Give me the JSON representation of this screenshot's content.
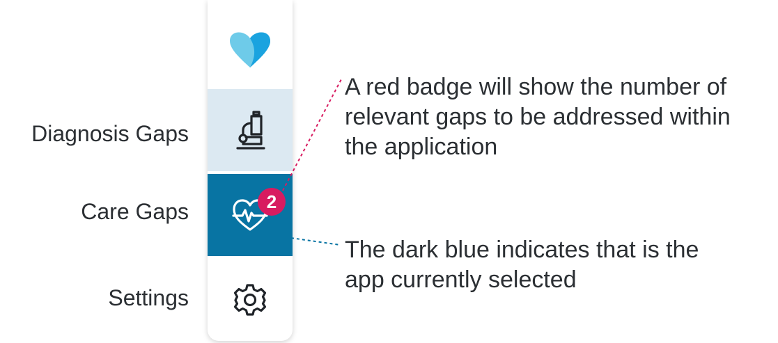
{
  "sidebar": {
    "items": [
      {
        "id": "logo",
        "icon": "heart-logo-icon"
      },
      {
        "id": "diagnosis-gaps",
        "label": "Diagnosis Gaps",
        "icon": "microscope-icon",
        "state": "hover"
      },
      {
        "id": "care-gaps",
        "label": "Care Gaps",
        "icon": "heartbeat-icon",
        "state": "selected",
        "badge": "2"
      },
      {
        "id": "settings",
        "label": "Settings",
        "icon": "gear-icon"
      }
    ]
  },
  "callouts": {
    "badge_lines": [
      "A red badge will show the number of",
      "relevant gaps to be addressed within",
      "the application"
    ],
    "selected_lines": [
      "The dark blue indicates that is the",
      "app currently selected"
    ]
  },
  "colors": {
    "selected_bg": "#0874a3",
    "hover_bg": "#dce9f2",
    "badge": "#d81b60",
    "logo_light": "#6ecbe9",
    "logo_dark": "#1aa3df",
    "connector_red": "#d81b60",
    "connector_blue": "#0874a3"
  }
}
